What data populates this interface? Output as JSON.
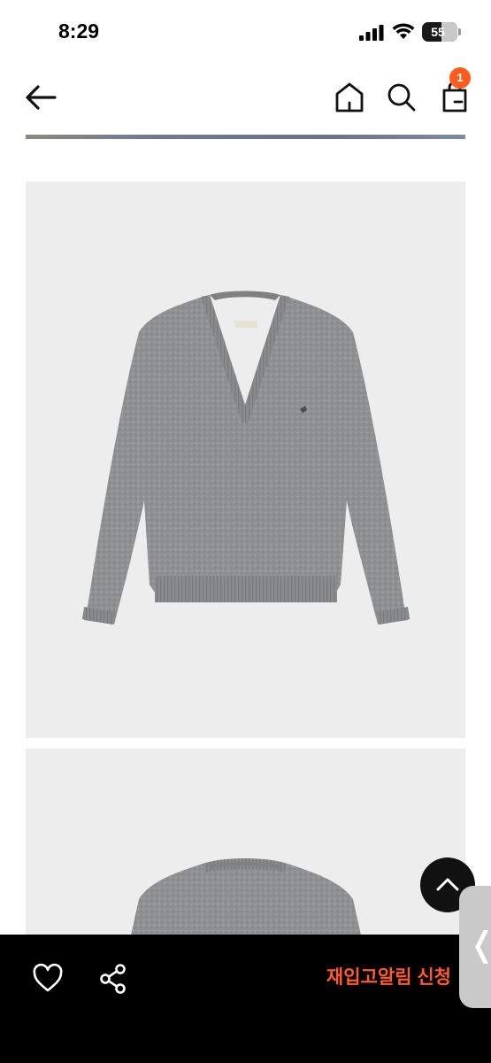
{
  "status_bar": {
    "time": "8:29",
    "battery_percent": "55",
    "battery_level": 0.55,
    "icons": [
      "signal-icon",
      "wifi-icon",
      "battery-icon"
    ]
  },
  "header": {
    "icons": [
      "back-arrow-icon",
      "home-icon",
      "search-icon",
      "shopping-bag-icon"
    ],
    "cart_count": "1",
    "accent_color": "#ff5b1f"
  },
  "product": {
    "images": [
      "grey-v-neck-sweater-front",
      "grey-sweater-back"
    ],
    "image_background": "#ededed"
  },
  "bottom_bar": {
    "restock_label": "재입고알림 신청",
    "restock_color": "#ff5a2a",
    "icons": [
      "heart-icon",
      "share-icon"
    ]
  },
  "floating": {
    "scroll_top_icon": "chevron-up-icon",
    "side_handle_glyph": "❬"
  }
}
